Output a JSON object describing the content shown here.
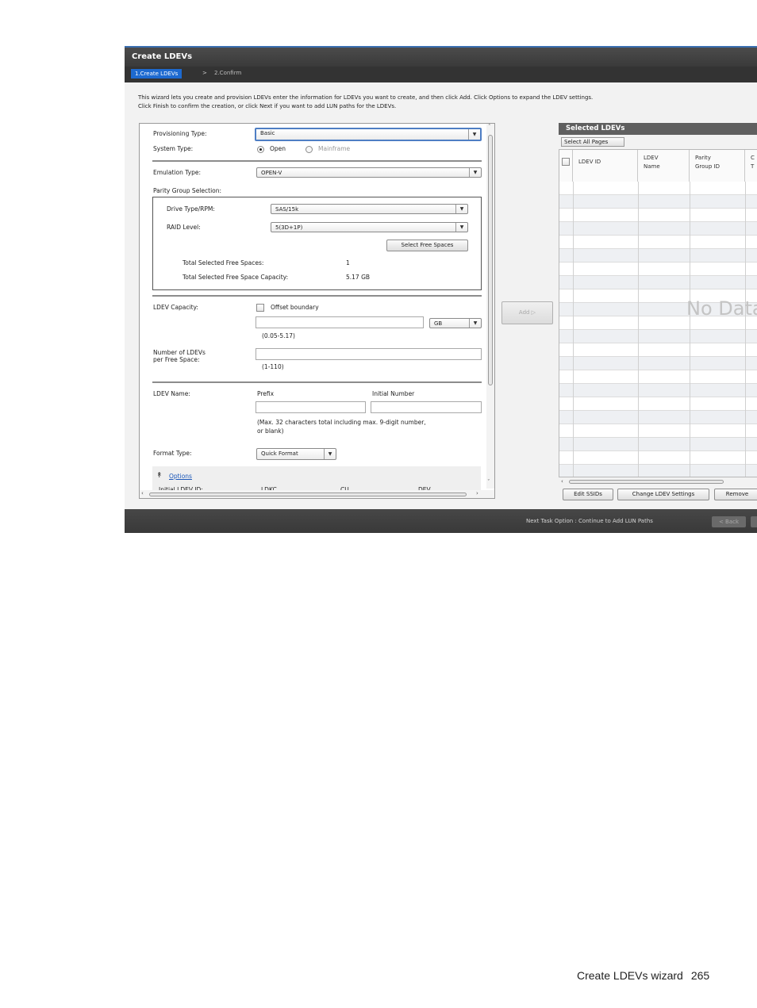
{
  "window": {
    "title": "Create LDEVs",
    "steps": [
      {
        "label": "1.Create LDEVs",
        "active": true
      },
      {
        "label": "2.Confirm",
        "active": false
      }
    ],
    "step_separator": ">",
    "intro_line1": "This wizard lets you create and provision LDEVs enter the information for  LDEVs you want to create, and then click Add. Click Options to expand the LDEV settings.",
    "intro_line2": "Click Finish to confirm the creation, or click Next if you want to add LUN paths for the LDEVs."
  },
  "form": {
    "provisioning_type": {
      "label": "Provisioning Type:",
      "value": "Basic"
    },
    "system_type": {
      "label": "System Type:",
      "options": [
        "Open",
        "Mainframe"
      ],
      "selected": "Open"
    },
    "emulation_type": {
      "label": "Emulation Type:",
      "value": "OPEN-V"
    },
    "parity_group_selection": {
      "label": "Parity Group Selection:",
      "drive_type": {
        "label": "Drive Type/RPM:",
        "value": "SAS/15k"
      },
      "raid_level": {
        "label": "RAID Level:",
        "value": "5(3D+1P)"
      },
      "select_free_spaces_button": "Select Free Spaces",
      "total_free_spaces": {
        "label": "Total Selected Free Spaces:",
        "value": "1"
      },
      "total_free_space_capacity": {
        "label": "Total Selected Free Space Capacity:",
        "value": "5.17 GB"
      }
    },
    "ldev_capacity": {
      "label": "LDEV Capacity:",
      "offset_boundary": "Offset boundary",
      "value": "",
      "unit": "GB",
      "range": "(0.05-5.17)"
    },
    "number_of_ldevs": {
      "label_line1": "Number of LDEVs",
      "label_line2": "per Free Space:",
      "value": "",
      "range": "(1-110)"
    },
    "ldev_name": {
      "label": "LDEV Name:",
      "prefix_label": "Prefix",
      "initial_number_label": "Initial Number",
      "prefix_value": "",
      "initial_number_value": "",
      "hint_line1": "(Max. 32 characters total including max. 9-digit number,",
      "hint_line2": " or blank)"
    },
    "format_type": {
      "label": "Format Type:",
      "value": "Quick Format"
    },
    "options_link": "Options",
    "options_columns": [
      "Initial LDEV ID:",
      "LDKC",
      "CU",
      "DEV"
    ]
  },
  "add_button": "Add ▷",
  "selected_ldevs": {
    "title": "Selected LDEVs",
    "select_all_pages": "Select All Pages",
    "columns": [
      {
        "line1": "LDEV ID",
        "line2": ""
      },
      {
        "line1": "LDEV",
        "line2": "Name"
      },
      {
        "line1": "Parity",
        "line2": "Group ID"
      },
      {
        "line1": "C",
        "line2": "T"
      }
    ],
    "empty_text": "No Data",
    "buttons": [
      "Edit SSIDs",
      "Change LDEV Settings",
      "Remove"
    ]
  },
  "footer": {
    "next_task": "Next Task Option : Continue to Add LUN Paths",
    "back_button": "< Back"
  },
  "page": {
    "caption": "Create LDEVs wizard",
    "number": "265"
  }
}
